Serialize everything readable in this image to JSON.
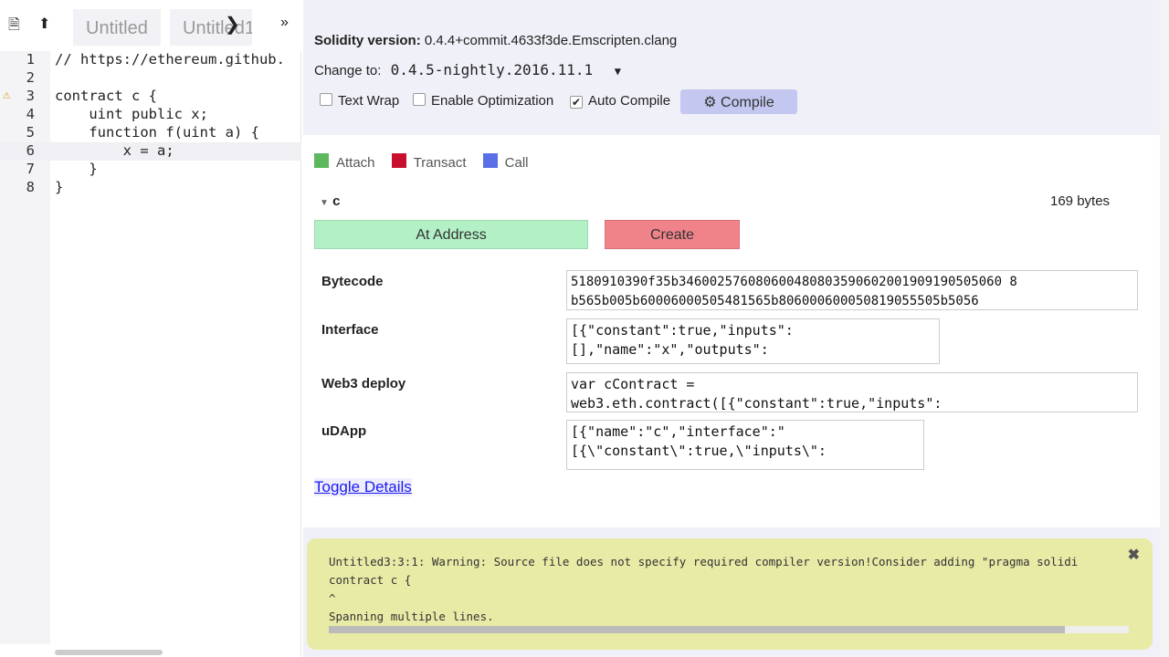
{
  "editor": {
    "tabs": [
      "Untitled",
      "Untitled1"
    ],
    "more_icon": "double-chevron-right",
    "lines": [
      {
        "n": "1",
        "text": "// https://ethereum.github."
      },
      {
        "n": "2",
        "text": ""
      },
      {
        "n": "3",
        "text": "contract c {",
        "warning": true
      },
      {
        "n": "4",
        "text": "    uint public x;"
      },
      {
        "n": "5",
        "text": "    function f(uint a) {"
      },
      {
        "n": "6",
        "text": "        x = a;"
      },
      {
        "n": "7",
        "text": "    }"
      },
      {
        "n": "8",
        "text": "}"
      }
    ]
  },
  "compiler": {
    "version_label": "Solidity version:",
    "version": "0.4.4+commit.4633f3de.Emscripten.clang",
    "change_label": "Change to:",
    "change_value": "0.4.5-nightly.2016.11.1",
    "text_wrap": "Text Wrap",
    "enable_opt": "Enable Optimization",
    "auto_compile": "Auto Compile",
    "auto_compile_checked": true,
    "compile": "Compile"
  },
  "legend": {
    "attach": "Attach",
    "transact": "Transact",
    "call": "Call",
    "colors": {
      "attach": "#5cb85c",
      "transact": "#c8102e",
      "call": "#5a6ee6"
    }
  },
  "contract": {
    "name": "c",
    "size": "169 bytes",
    "at_address": "At Address",
    "create": "Create",
    "bytecode_label": "Bytecode",
    "bytecode": "5180910390f35b346002576080600480803590602001909190505060 8\nb565b005b60006000505481565b806000600050819055505b5056",
    "interface_label": "Interface",
    "interface": "[{\"constant\":true,\"inputs\":\n[],\"name\":\"x\",\"outputs\":",
    "web3_label": "Web3 deploy",
    "web3": "var cContract =\nweb3.eth.contract([{\"constant\":true,\"inputs\":",
    "udapp_label": "uDApp",
    "udapp": "[{\"name\":\"c\",\"interface\":\"\n[{\\\"constant\\\":true,\\\"inputs\\\":",
    "toggle": "Toggle Details"
  },
  "warning": {
    "line1": "Untitled3:3:1: Warning: Source file does not specify required compiler version!Consider adding \"pragma solidi",
    "line2": "contract c {",
    "line3": "^",
    "line4": "Spanning multiple lines."
  }
}
